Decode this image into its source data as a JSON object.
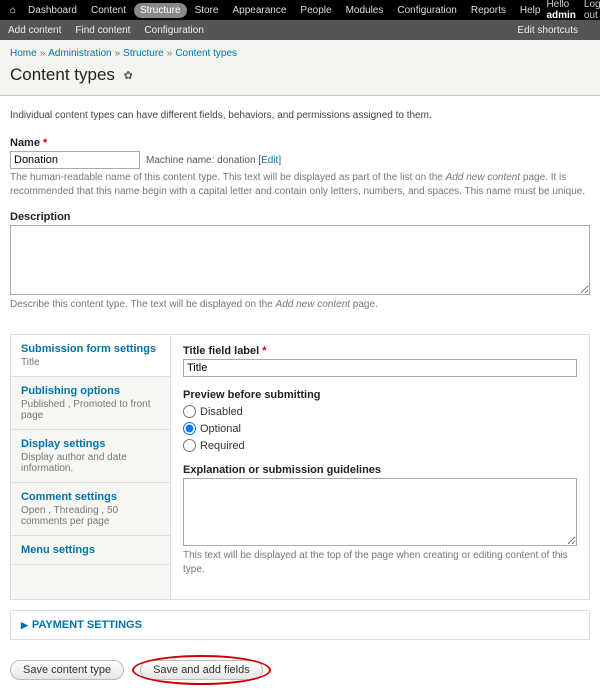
{
  "topbar": {
    "menu": [
      "Dashboard",
      "Content",
      "Structure",
      "Store",
      "Appearance",
      "People",
      "Modules",
      "Configuration",
      "Reports",
      "Help"
    ],
    "active_index": 2,
    "hello_prefix": "Hello ",
    "hello_user": "admin",
    "logout": "Log out"
  },
  "subbar": {
    "items": [
      "Add content",
      "Find content",
      "Configuration"
    ],
    "right": "Edit shortcuts"
  },
  "breadcrumb": [
    "Home",
    "Administration",
    "Structure",
    "Content types"
  ],
  "page_title": "Content types",
  "intro": "Individual content types can have different fields, behaviors, and permissions assigned to them.",
  "name": {
    "label": "Name",
    "value": "Donation",
    "machine_prefix": "Machine name: ",
    "machine_value": "donation",
    "edit_label": "Edit",
    "help_1": "The human-readable name of this content type. This text will be displayed as part of the list on the ",
    "help_em": "Add new content",
    "help_2": " page. It is recommended that this name begin with a capital letter and contain only letters, numbers, and spaces. This name must be unique."
  },
  "description": {
    "label": "Description",
    "value": "",
    "help_1": "Describe this content type. The text will be displayed on the ",
    "help_em": "Add new content",
    "help_2": " page."
  },
  "vtabs": [
    {
      "title": "Submission form settings",
      "summary": "Title"
    },
    {
      "title": "Publishing options",
      "summary": "Published , Promoted to front page"
    },
    {
      "title": "Display settings",
      "summary": "Display author and date information."
    },
    {
      "title": "Comment settings",
      "summary": "Open , Threading , 50 comments per page"
    },
    {
      "title": "Menu settings",
      "summary": ""
    }
  ],
  "pane": {
    "title_label": "Title field label",
    "title_value": "Title",
    "preview_label": "Preview before submitting",
    "preview_options": [
      "Disabled",
      "Optional",
      "Required"
    ],
    "preview_selected": 1,
    "explain_label": "Explanation or submission guidelines",
    "explain_value": "",
    "explain_help": "This text will be displayed at the top of the page when creating or editing content of this type."
  },
  "payment_legend": "PAYMENT SETTINGS",
  "buttons": {
    "save": "Save content type",
    "save_add": "Save and add fields"
  }
}
